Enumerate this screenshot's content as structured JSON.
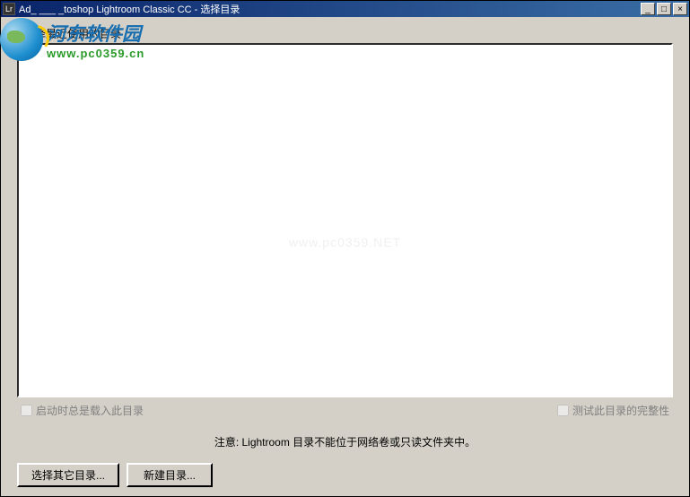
{
  "titlebar": {
    "icon_label": "Lr",
    "title": "Ad_  ___  _toshop Lightroom Classic CC - 选择目录"
  },
  "window_controls": {
    "minimize": "_",
    "maximize": "□",
    "close": "×"
  },
  "group": {
    "label": "选择最近使用的目录"
  },
  "checkboxes": {
    "always_load": "启动时总是载入此目录",
    "test_integrity": "测试此目录的完整性"
  },
  "note": "注意: Lightroom 目录不能位于网络卷或只读文件夹中。",
  "buttons": {
    "choose_other": "选择其它目录...",
    "create_new": "新建目录..."
  },
  "watermark": {
    "site_name": "河东软件园",
    "site_url": "www.pc0359.cn",
    "faint": "www.pc0359.NET"
  }
}
